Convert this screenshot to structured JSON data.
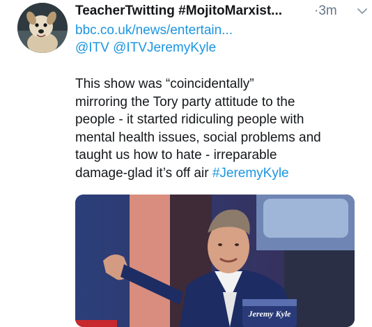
{
  "tweet": {
    "display_name": "TeacherTwitting #MojitoMarxist...",
    "timestamp": "·3m",
    "link": "bbc.co.uk/news/entertain...",
    "mentions": "@ITV @ITVJeremyKyle",
    "text_lines": [
      "This show was “coincidentally”",
      "mirroring the Tory party attitude to the",
      "people - it started ridiculing people with",
      "mental health issues, social problems and",
      "taught us how to hate - irreparable"
    ],
    "text_last_prefix": "damage-glad it’s off air ",
    "hashtag": "#JeremyKyle",
    "media_caption": "Jeremy Kyle",
    "icons": {
      "avatar": "dog-avatar",
      "menu": "chevron-down-icon"
    },
    "colors": {
      "link": "#1b95e0",
      "text": "#14171a",
      "muted": "#657786"
    }
  }
}
